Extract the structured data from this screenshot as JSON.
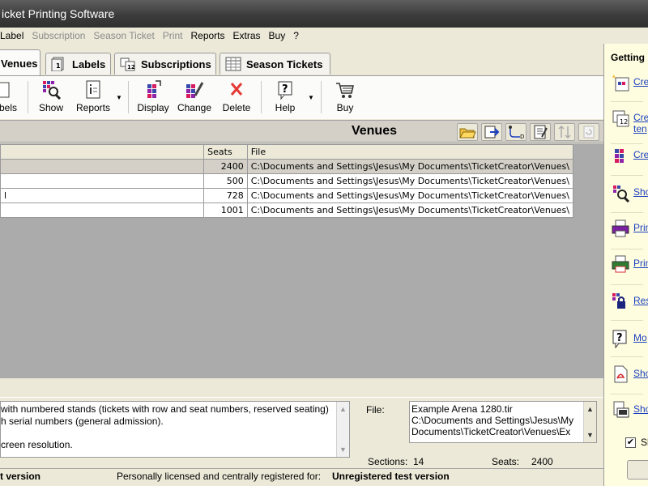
{
  "window": {
    "title": "icket Printing Software"
  },
  "menu": [
    {
      "label": "Label",
      "enabled": true
    },
    {
      "label": "Subscription",
      "enabled": false
    },
    {
      "label": "Season Ticket",
      "enabled": false
    },
    {
      "label": "Print",
      "enabled": false
    },
    {
      "label": "Reports",
      "enabled": true
    },
    {
      "label": "Extras",
      "enabled": true
    },
    {
      "label": "Buy",
      "enabled": true
    },
    {
      "label": "?",
      "enabled": true
    }
  ],
  "tabs": [
    {
      "label": "Venues",
      "icon": "venue-icon",
      "active": true
    },
    {
      "label": "Labels",
      "icon": "label-icon",
      "active": false
    },
    {
      "label": "Subscriptions",
      "icon": "subscriptions-icon",
      "active": false
    },
    {
      "label": "Season Tickets",
      "icon": "season-tickets-icon",
      "active": false
    }
  ],
  "toolbar": {
    "labels": "bels",
    "show": "Show",
    "reports": "Reports",
    "display": "Display",
    "change": "Change",
    "delete": "Delete",
    "help": "Help",
    "buy": "Buy"
  },
  "pane": {
    "title": "Venues"
  },
  "table": {
    "columns": [
      "",
      "Seats",
      "File"
    ],
    "rows": [
      {
        "name": "",
        "seats": "2400",
        "file": "C:\\Documents and Settings\\Jesus\\My Documents\\TicketCreator\\Venues\\",
        "selected": true
      },
      {
        "name": "",
        "seats": "500",
        "file": "C:\\Documents and Settings\\Jesus\\My Documents\\TicketCreator\\Venues\\",
        "selected": false
      },
      {
        "name": "l",
        "seats": "728",
        "file": "C:\\Documents and Settings\\Jesus\\My Documents\\TicketCreator\\Venues\\",
        "selected": false
      },
      {
        "name": "",
        "seats": "1001",
        "file": "C:\\Documents and Settings\\Jesus\\My Documents\\TicketCreator\\Venues\\",
        "selected": false
      }
    ]
  },
  "details": {
    "description": [
      "with numbered stands (tickets with row and seat numbers, reserved seating)",
      "h serial numbers (general admission).",
      "",
      "creen resolution."
    ],
    "file_label": "File:",
    "file_lines": [
      "Example Arena 1280.tir",
      "C:\\Documents and Settings\\Jesus\\My",
      "Documents\\TicketCreator\\Venues\\Ex"
    ],
    "sections_label": "Sections:",
    "sections_value": "14",
    "seats_label": "Seats:",
    "seats_value": "2400"
  },
  "status": {
    "left": "t version",
    "middle": "Personally licensed and centrally registered for:",
    "registered": "Unregistered test version"
  },
  "sidebar": {
    "title": "Getting",
    "items": [
      {
        "label": "Cre",
        "icon": "create-venue-icon"
      },
      {
        "label": "Cre",
        "label2": "ten",
        "icon": "create-template-icon"
      },
      {
        "label": "Cre",
        "icon": "create-seating-icon"
      },
      {
        "label": "Sho",
        "icon": "show-venue-icon"
      },
      {
        "label": "Prin",
        "icon": "print-icon"
      },
      {
        "label": "Prin",
        "icon": "print-color-icon"
      },
      {
        "label": "Res",
        "icon": "reserve-lock-icon"
      },
      {
        "label": "Mo",
        "icon": "help-more-icon"
      },
      {
        "label": "Sho",
        "icon": "pdf-icon"
      },
      {
        "label": "Sho",
        "icon": "show-video-icon"
      }
    ],
    "checkbox_label": "Sl",
    "checkbox_checked": true
  }
}
